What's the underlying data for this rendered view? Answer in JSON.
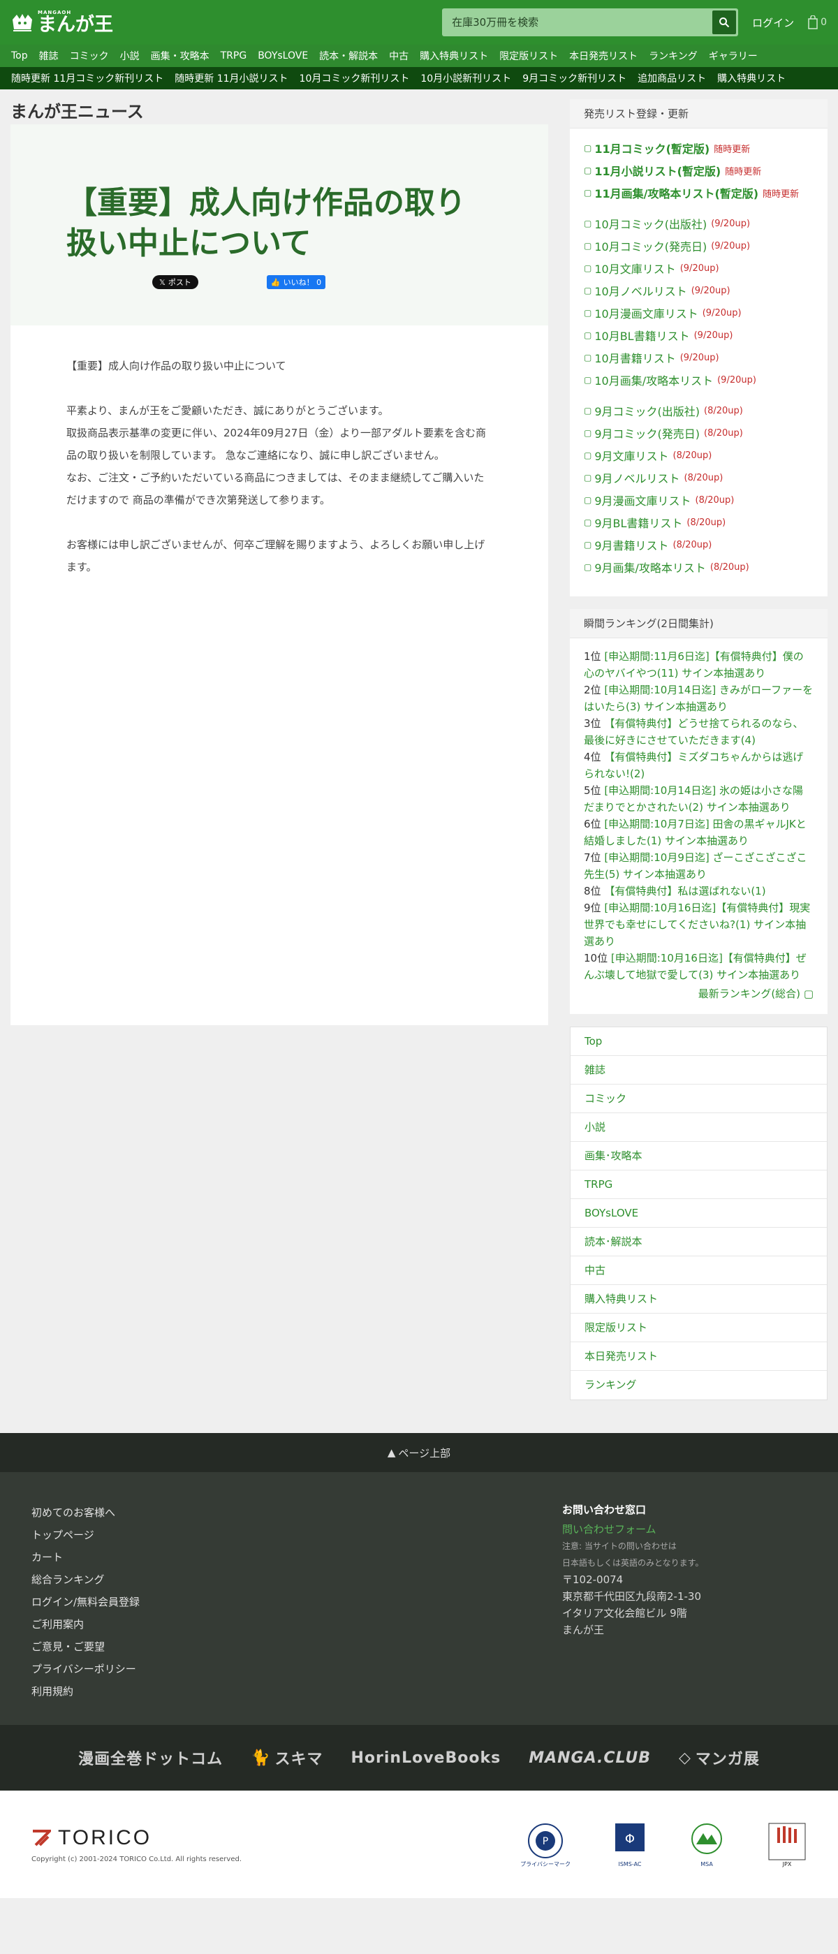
{
  "header": {
    "logo_small": "MANGAOH",
    "logo_text": "まんが王",
    "search_placeholder": "在庫30万冊を検索",
    "login": "ログイン",
    "cart_count": "0"
  },
  "nav_main": [
    "Top",
    "雑誌",
    "コミック",
    "小説",
    "画集・攻略本",
    "TRPG",
    "BOYsLOVE",
    "読本・解説本",
    "中古",
    "購入特典リスト",
    "限定版リスト",
    "本日発売リスト",
    "ランキング",
    "ギャラリー"
  ],
  "nav_sub": [
    "随時更新 11月コミック新刊リスト",
    "随時更新 11月小説リスト",
    "10月コミック新刊リスト",
    "10月小説新刊リスト",
    "9月コミック新刊リスト",
    "追加商品リスト",
    "購入特典リスト"
  ],
  "main": {
    "section_title": "まんが王ニュース",
    "article_title": "【重要】成人向け作品の取り扱い中止について",
    "x_post": "ポスト",
    "fb_like": "いいね！ 0",
    "paragraphs": [
      "【重要】成人向け作品の取り扱い中止について",
      "平素より、まんが王をご愛顧いただき、誠にありがとうございます。\n取扱商品表示基準の変更に伴い、2024年09月27日（金）より一部アダルト要素を含む商品の取り扱いを制限しています。 急なご連絡になり、誠に申し訳ございません。\nなお、ご注文・ご予約いただいている商品につきましては、そのまま継続してご購入いただけますので 商品の準備ができ次第発送して参ります。",
      "お客様には申し訳ございませんが、何卒ご理解を賜りますよう、よろしくお願い申し上げます。"
    ]
  },
  "sidebar": {
    "release_title": "発売リスト登録・更新",
    "release_groups": [
      [
        {
          "label": "11月コミック(暫定版)",
          "note": "随時更新",
          "bold": true
        },
        {
          "label": "11月小説リスト(暫定版)",
          "note": "随時更新",
          "bold": true
        },
        {
          "label": "11月画集/攻略本リスト(暫定版)",
          "note": "随時更新",
          "bold": true
        }
      ],
      [
        {
          "label": "10月コミック(出版社)",
          "note": "(9/20up)"
        },
        {
          "label": "10月コミック(発売日)",
          "note": "(9/20up)"
        },
        {
          "label": "10月文庫リスト",
          "note": "(9/20up)"
        },
        {
          "label": "10月ノベルリスト",
          "note": "(9/20up)"
        },
        {
          "label": "10月漫画文庫リスト",
          "note": "(9/20up)"
        },
        {
          "label": "10月BL書籍リスト",
          "note": "(9/20up)"
        },
        {
          "label": "10月書籍リスト",
          "note": "(9/20up)"
        },
        {
          "label": "10月画集/攻略本リスト",
          "note": "(9/20up)"
        }
      ],
      [
        {
          "label": "9月コミック(出版社)",
          "note": "(8/20up)"
        },
        {
          "label": "9月コミック(発売日)",
          "note": "(8/20up)"
        },
        {
          "label": "9月文庫リスト",
          "note": "(8/20up)"
        },
        {
          "label": "9月ノベルリスト",
          "note": "(8/20up)"
        },
        {
          "label": "9月漫画文庫リスト",
          "note": "(8/20up)"
        },
        {
          "label": "9月BL書籍リスト",
          "note": "(8/20up)"
        },
        {
          "label": "9月書籍リスト",
          "note": "(8/20up)"
        },
        {
          "label": "9月画集/攻略本リスト",
          "note": "(8/20up)"
        }
      ]
    ],
    "ranking_title": "瞬間ランキング(2日間集計)",
    "ranking": [
      {
        "pos": "1位",
        "title": "[申込期間:11月6日迄]【有償特典付】僕の心のヤバイやつ(11) サイン本抽選あり"
      },
      {
        "pos": "2位",
        "title": "[申込期間:10月14日迄] きみがローファーをはいたら(3) サイン本抽選あり"
      },
      {
        "pos": "3位",
        "title": "【有償特典付】どうせ捨てられるのなら、最後に好きにさせていただきます(4)"
      },
      {
        "pos": "4位",
        "title": "【有償特典付】ミズダコちゃんからは逃げられない!(2)"
      },
      {
        "pos": "5位",
        "title": "[申込期間:10月14日迄] 氷の姫は小さな陽だまりでとかされたい(2) サイン本抽選あり"
      },
      {
        "pos": "6位",
        "title": "[申込期間:10月7日迄] 田舎の黒ギャルJKと結婚しました(1) サイン本抽選あり"
      },
      {
        "pos": "7位",
        "title": "[申込期間:10月9日迄] ざーこざこざこざこ先生(5) サイン本抽選あり"
      },
      {
        "pos": "8位",
        "title": "【有償特典付】私は選ばれない(1)"
      },
      {
        "pos": "9位",
        "title": "[申込期間:10月16日迄]【有償特典付】現実世界でも幸せにしてくださいね?(1) サイン本抽選あり"
      },
      {
        "pos": "10位",
        "title": "[申込期間:10月16日迄]【有償特典付】ぜんぶ壊して地獄で愛して(3) サイン本抽選あり"
      }
    ],
    "ranking_more": "最新ランキング(総合)",
    "menu": [
      "Top",
      "雑誌",
      "コミック",
      "小説",
      "画集･攻略本",
      "TRPG",
      "BOYsLOVE",
      "読本･解説本",
      "中古",
      "購入特典リスト",
      "限定版リスト",
      "本日発売リスト",
      "ランキング"
    ]
  },
  "footer": {
    "pagetop": "ページ上部",
    "links": [
      "初めてのお客様へ",
      "トップページ",
      "カート",
      "総合ランキング",
      "ログイン/無料会員登録",
      "ご利用案内",
      "ご意見・ご要望",
      "プライバシーポリシー",
      "利用規約"
    ],
    "contact_title": "お問い合わせ窓口",
    "contact_link": "問い合わせフォーム",
    "contact_note1": "注意: 当サイトの問い合わせは",
    "contact_note2": "日本語もしくは英語のみとなります。",
    "postal": "〒102-0074",
    "address1": "東京都千代田区九段南2-1-30",
    "address2": "イタリア文化会館ビル 9階",
    "company": "まんが王",
    "partners": [
      "漫画全巻ドットコム",
      "スキマ",
      "HorinLoveBooks",
      "MANGA.CLUB",
      "マンガ展"
    ],
    "torico": "TORICO",
    "copyright": "Copyright (c) 2001-2024 TORICO Co.Ltd. All rights reserved.",
    "certs": [
      "プライバシーマーク",
      "ISMS-AC",
      "MSA",
      "JPX"
    ]
  },
  "colors": {
    "brand": "#2e8f2e",
    "nav_dark": "#0f4a0f",
    "note_red": "#c62d2d"
  }
}
